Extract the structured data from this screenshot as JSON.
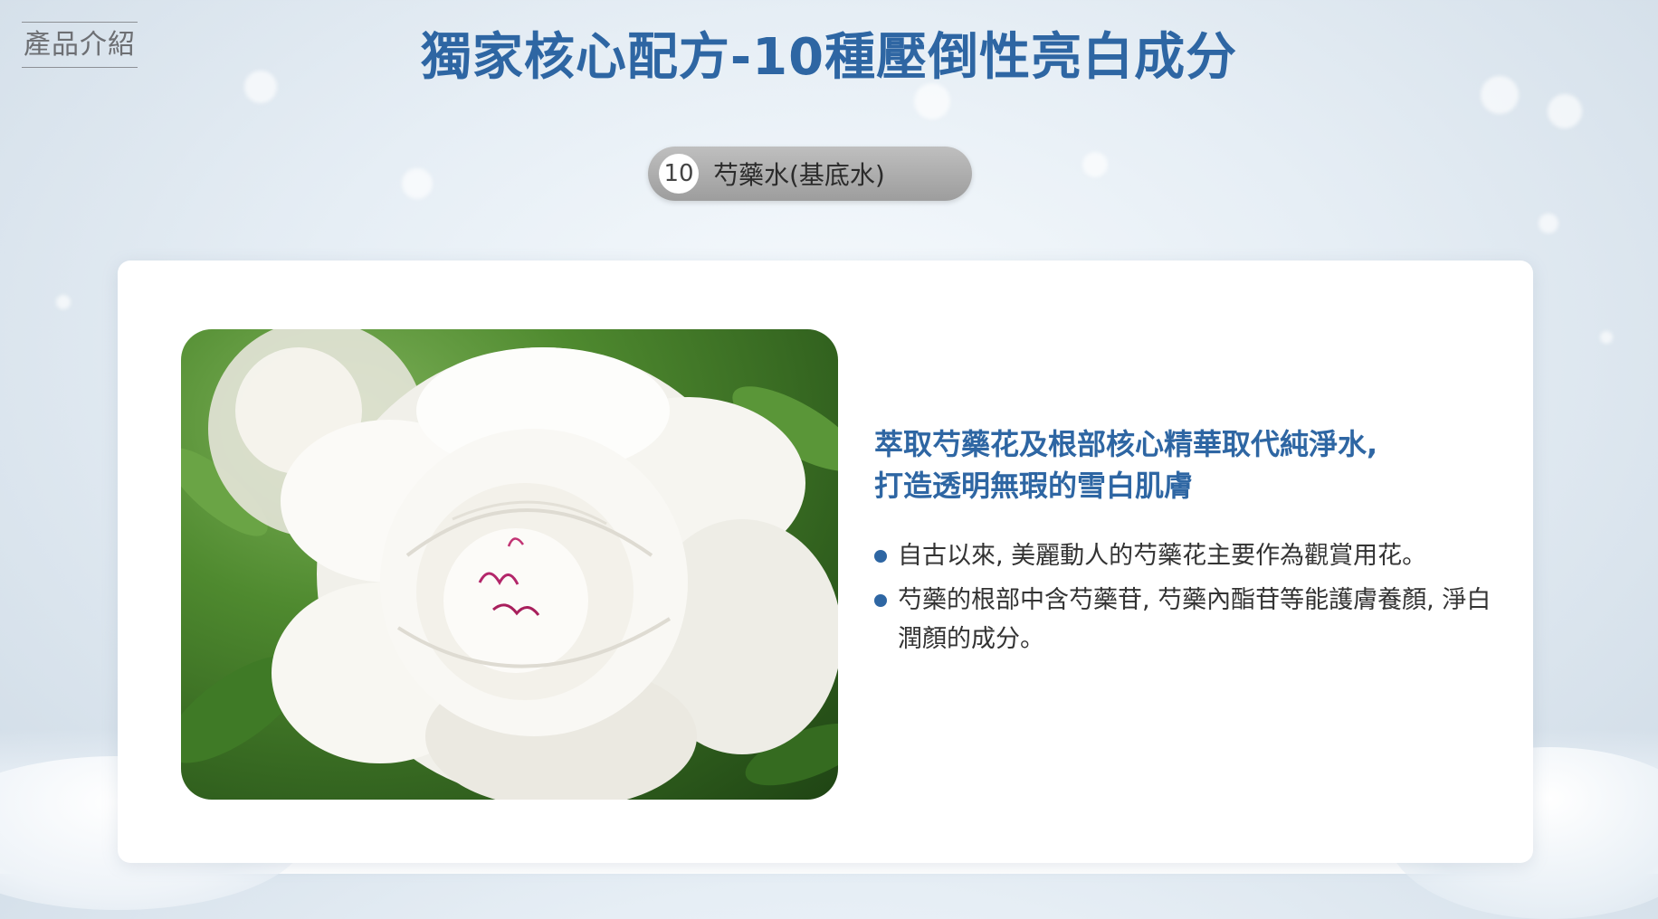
{
  "product_tag": "產品介紹",
  "headline": "獨家核心配方-10種壓倒性亮白成分",
  "ingredient": {
    "number": "10",
    "name": "芍藥水(基底水)"
  },
  "detail": {
    "title_line1": "萃取芍藥花及根部核心精華取代純淨水,",
    "title_line2": "打造透明無瑕的雪白肌膚",
    "bullets": [
      "自古以來, 美麗動人的芍藥花主要作為觀賞用花。",
      "芍藥的根部中含芍藥苷, 芍藥內酯苷等能護膚養顏, 淨白潤顏的成分。"
    ]
  },
  "colors": {
    "accent": "#2e66a3",
    "pill": "#a9a9a9"
  }
}
